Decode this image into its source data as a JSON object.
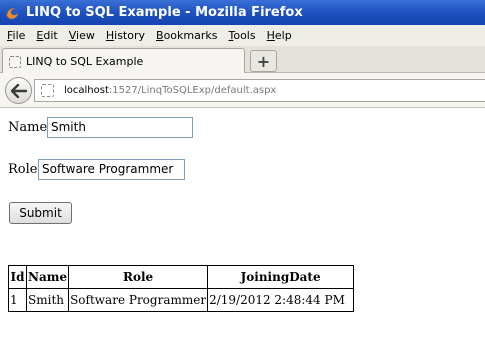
{
  "window": {
    "title": "LINQ to SQL Example - Mozilla Firefox"
  },
  "menu": {
    "items": [
      {
        "access": "F",
        "rest": "ile"
      },
      {
        "access": "E",
        "rest": "dit"
      },
      {
        "access": "V",
        "rest": "iew"
      },
      {
        "access": "H",
        "rest": "istory"
      },
      {
        "access": "B",
        "rest": "ookmarks"
      },
      {
        "access": "T",
        "rest": "ools"
      },
      {
        "access": "H",
        "rest": "elp"
      }
    ]
  },
  "tabs": {
    "active_label": "LINQ to SQL Example",
    "new_tab_symbol": "+"
  },
  "address": {
    "host": "localhost",
    "path": ":1527/LinqToSQLExp/default.aspx"
  },
  "form": {
    "name_label": "Name:",
    "name_value": "Smith",
    "role_label": "Role:",
    "role_value": "Software Programmer",
    "submit_label": "Submit"
  },
  "table": {
    "headers": [
      "Id",
      "Name",
      "Role",
      "JoiningDate"
    ],
    "rows": [
      [
        "1",
        "Smith",
        "Software Programmer",
        "2/19/2012 2:48:44 PM"
      ]
    ]
  },
  "colors": {
    "titlebar": "#1c4fbe",
    "textbox_border": "#7f9db9"
  }
}
